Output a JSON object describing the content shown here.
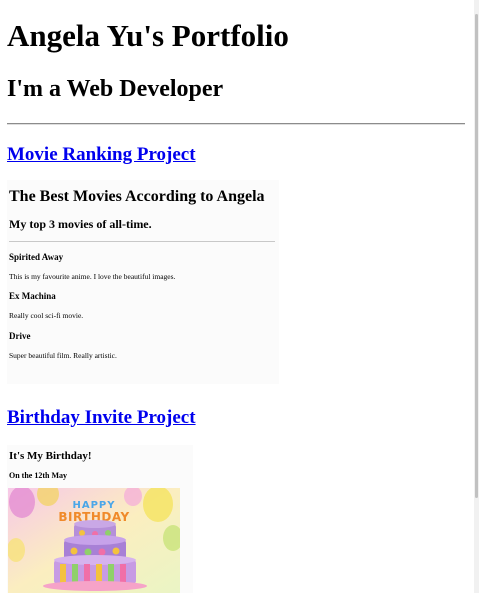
{
  "header": {
    "title": "Angela Yu's Portfolio",
    "subtitle": "I'm a Web Developer"
  },
  "projects": [
    {
      "link_label": "Movie Ranking Project",
      "preview": {
        "title": "The Best Movies According to Angela",
        "subtitle": "My top 3 movies of all-time.",
        "movies": [
          {
            "name": "Spirited Away",
            "desc": "This is my favourite anime. I love the beautiful images."
          },
          {
            "name": "Ex Machina",
            "desc": "Really cool sci-fi movie."
          },
          {
            "name": "Drive",
            "desc": "Super beautiful film. Really artistic."
          }
        ]
      }
    },
    {
      "link_label": "Birthday Invite Project",
      "preview": {
        "title": "It's My Birthday!",
        "date": "On the 12th May",
        "cake_text": "HAPPY BIRTHDAY"
      }
    }
  ],
  "colors": {
    "link": "#0000ee",
    "rule": "#8c8c8c"
  }
}
